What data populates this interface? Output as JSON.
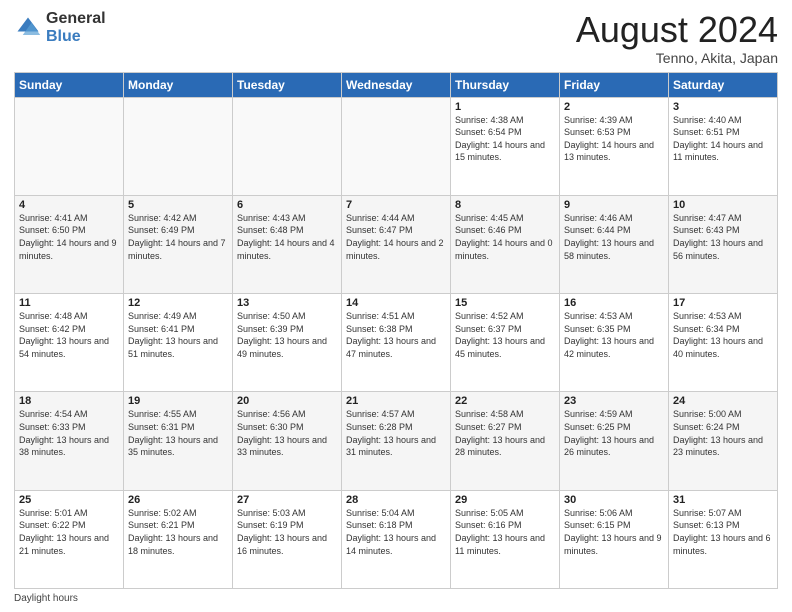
{
  "logo": {
    "general": "General",
    "blue": "Blue"
  },
  "title": "August 2024",
  "subtitle": "Tenno, Akita, Japan",
  "days_of_week": [
    "Sunday",
    "Monday",
    "Tuesday",
    "Wednesday",
    "Thursday",
    "Friday",
    "Saturday"
  ],
  "footer": {
    "daylight_label": "Daylight hours"
  },
  "weeks": [
    [
      {
        "day": "",
        "sunrise": "",
        "sunset": "",
        "daylight": ""
      },
      {
        "day": "",
        "sunrise": "",
        "sunset": "",
        "daylight": ""
      },
      {
        "day": "",
        "sunrise": "",
        "sunset": "",
        "daylight": ""
      },
      {
        "day": "",
        "sunrise": "",
        "sunset": "",
        "daylight": ""
      },
      {
        "day": "1",
        "sunrise": "Sunrise: 4:38 AM",
        "sunset": "Sunset: 6:54 PM",
        "daylight": "Daylight: 14 hours and 15 minutes."
      },
      {
        "day": "2",
        "sunrise": "Sunrise: 4:39 AM",
        "sunset": "Sunset: 6:53 PM",
        "daylight": "Daylight: 14 hours and 13 minutes."
      },
      {
        "day": "3",
        "sunrise": "Sunrise: 4:40 AM",
        "sunset": "Sunset: 6:51 PM",
        "daylight": "Daylight: 14 hours and 11 minutes."
      }
    ],
    [
      {
        "day": "4",
        "sunrise": "Sunrise: 4:41 AM",
        "sunset": "Sunset: 6:50 PM",
        "daylight": "Daylight: 14 hours and 9 minutes."
      },
      {
        "day": "5",
        "sunrise": "Sunrise: 4:42 AM",
        "sunset": "Sunset: 6:49 PM",
        "daylight": "Daylight: 14 hours and 7 minutes."
      },
      {
        "day": "6",
        "sunrise": "Sunrise: 4:43 AM",
        "sunset": "Sunset: 6:48 PM",
        "daylight": "Daylight: 14 hours and 4 minutes."
      },
      {
        "day": "7",
        "sunrise": "Sunrise: 4:44 AM",
        "sunset": "Sunset: 6:47 PM",
        "daylight": "Daylight: 14 hours and 2 minutes."
      },
      {
        "day": "8",
        "sunrise": "Sunrise: 4:45 AM",
        "sunset": "Sunset: 6:46 PM",
        "daylight": "Daylight: 14 hours and 0 minutes."
      },
      {
        "day": "9",
        "sunrise": "Sunrise: 4:46 AM",
        "sunset": "Sunset: 6:44 PM",
        "daylight": "Daylight: 13 hours and 58 minutes."
      },
      {
        "day": "10",
        "sunrise": "Sunrise: 4:47 AM",
        "sunset": "Sunset: 6:43 PM",
        "daylight": "Daylight: 13 hours and 56 minutes."
      }
    ],
    [
      {
        "day": "11",
        "sunrise": "Sunrise: 4:48 AM",
        "sunset": "Sunset: 6:42 PM",
        "daylight": "Daylight: 13 hours and 54 minutes."
      },
      {
        "day": "12",
        "sunrise": "Sunrise: 4:49 AM",
        "sunset": "Sunset: 6:41 PM",
        "daylight": "Daylight: 13 hours and 51 minutes."
      },
      {
        "day": "13",
        "sunrise": "Sunrise: 4:50 AM",
        "sunset": "Sunset: 6:39 PM",
        "daylight": "Daylight: 13 hours and 49 minutes."
      },
      {
        "day": "14",
        "sunrise": "Sunrise: 4:51 AM",
        "sunset": "Sunset: 6:38 PM",
        "daylight": "Daylight: 13 hours and 47 minutes."
      },
      {
        "day": "15",
        "sunrise": "Sunrise: 4:52 AM",
        "sunset": "Sunset: 6:37 PM",
        "daylight": "Daylight: 13 hours and 45 minutes."
      },
      {
        "day": "16",
        "sunrise": "Sunrise: 4:53 AM",
        "sunset": "Sunset: 6:35 PM",
        "daylight": "Daylight: 13 hours and 42 minutes."
      },
      {
        "day": "17",
        "sunrise": "Sunrise: 4:53 AM",
        "sunset": "Sunset: 6:34 PM",
        "daylight": "Daylight: 13 hours and 40 minutes."
      }
    ],
    [
      {
        "day": "18",
        "sunrise": "Sunrise: 4:54 AM",
        "sunset": "Sunset: 6:33 PM",
        "daylight": "Daylight: 13 hours and 38 minutes."
      },
      {
        "day": "19",
        "sunrise": "Sunrise: 4:55 AM",
        "sunset": "Sunset: 6:31 PM",
        "daylight": "Daylight: 13 hours and 35 minutes."
      },
      {
        "day": "20",
        "sunrise": "Sunrise: 4:56 AM",
        "sunset": "Sunset: 6:30 PM",
        "daylight": "Daylight: 13 hours and 33 minutes."
      },
      {
        "day": "21",
        "sunrise": "Sunrise: 4:57 AM",
        "sunset": "Sunset: 6:28 PM",
        "daylight": "Daylight: 13 hours and 31 minutes."
      },
      {
        "day": "22",
        "sunrise": "Sunrise: 4:58 AM",
        "sunset": "Sunset: 6:27 PM",
        "daylight": "Daylight: 13 hours and 28 minutes."
      },
      {
        "day": "23",
        "sunrise": "Sunrise: 4:59 AM",
        "sunset": "Sunset: 6:25 PM",
        "daylight": "Daylight: 13 hours and 26 minutes."
      },
      {
        "day": "24",
        "sunrise": "Sunrise: 5:00 AM",
        "sunset": "Sunset: 6:24 PM",
        "daylight": "Daylight: 13 hours and 23 minutes."
      }
    ],
    [
      {
        "day": "25",
        "sunrise": "Sunrise: 5:01 AM",
        "sunset": "Sunset: 6:22 PM",
        "daylight": "Daylight: 13 hours and 21 minutes."
      },
      {
        "day": "26",
        "sunrise": "Sunrise: 5:02 AM",
        "sunset": "Sunset: 6:21 PM",
        "daylight": "Daylight: 13 hours and 18 minutes."
      },
      {
        "day": "27",
        "sunrise": "Sunrise: 5:03 AM",
        "sunset": "Sunset: 6:19 PM",
        "daylight": "Daylight: 13 hours and 16 minutes."
      },
      {
        "day": "28",
        "sunrise": "Sunrise: 5:04 AM",
        "sunset": "Sunset: 6:18 PM",
        "daylight": "Daylight: 13 hours and 14 minutes."
      },
      {
        "day": "29",
        "sunrise": "Sunrise: 5:05 AM",
        "sunset": "Sunset: 6:16 PM",
        "daylight": "Daylight: 13 hours and 11 minutes."
      },
      {
        "day": "30",
        "sunrise": "Sunrise: 5:06 AM",
        "sunset": "Sunset: 6:15 PM",
        "daylight": "Daylight: 13 hours and 9 minutes."
      },
      {
        "day": "31",
        "sunrise": "Sunrise: 5:07 AM",
        "sunset": "Sunset: 6:13 PM",
        "daylight": "Daylight: 13 hours and 6 minutes."
      }
    ]
  ]
}
